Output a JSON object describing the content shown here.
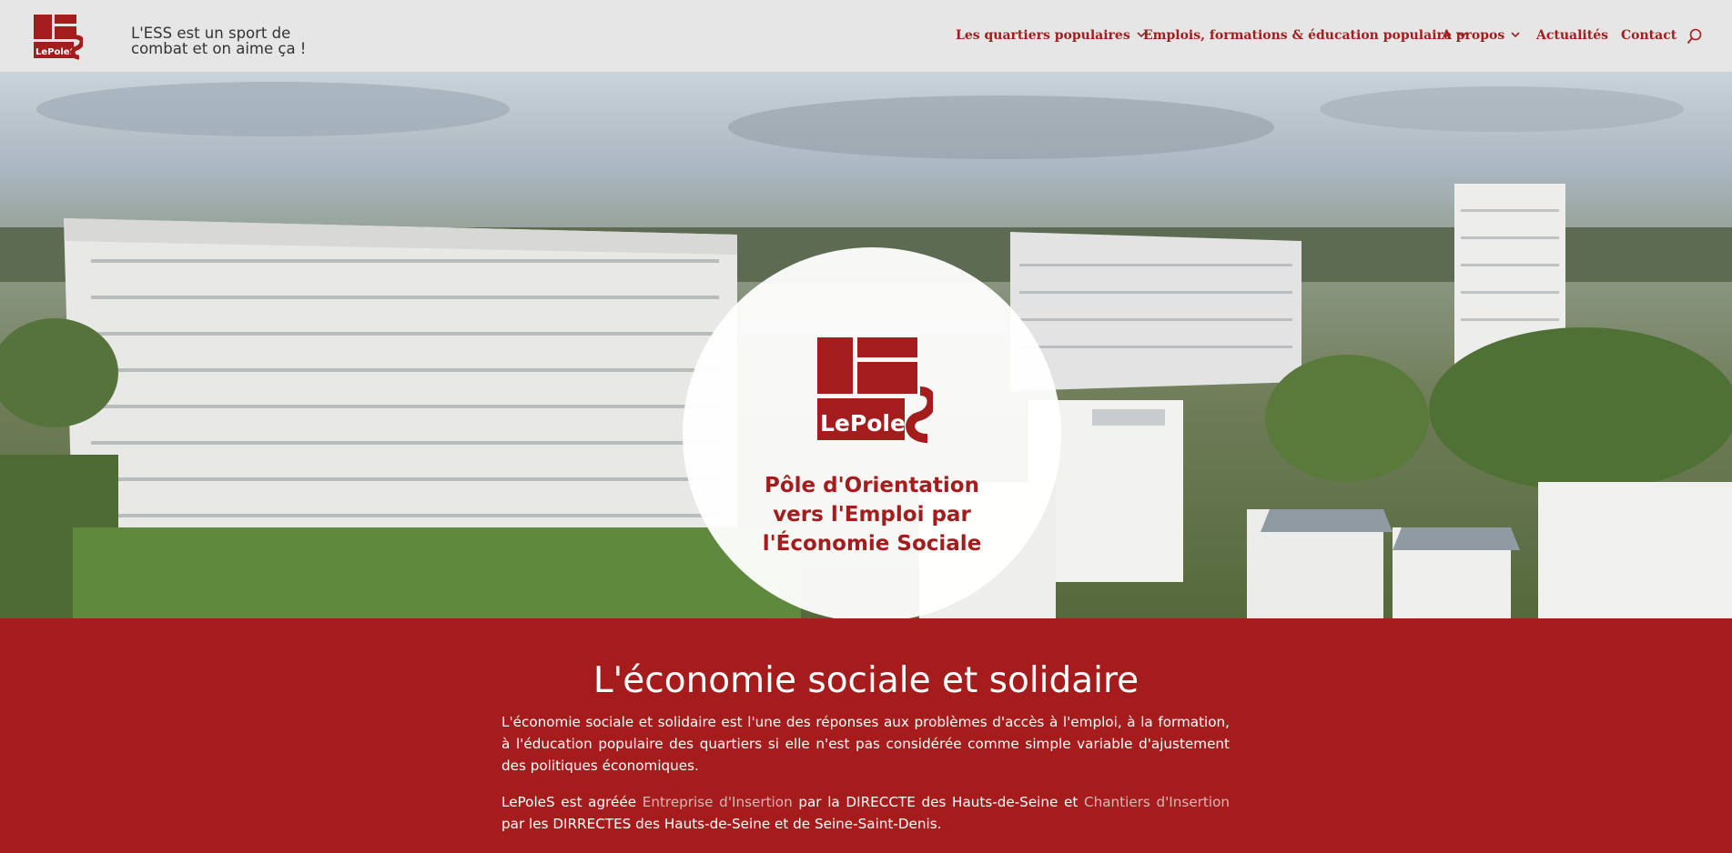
{
  "header": {
    "tagline": "L'ESS est un sport de combat et on aime ça !",
    "nav": [
      {
        "label": "Les quartiers populaires",
        "has_dropdown": true
      },
      {
        "label": "Emplois, formations & éducation populaire",
        "has_dropdown": true
      },
      {
        "label": "A propos",
        "has_dropdown": true
      },
      {
        "label": "Actualités",
        "has_dropdown": false
      },
      {
        "label": "Contact",
        "has_dropdown": false
      }
    ],
    "search_icon": "search-icon"
  },
  "hero": {
    "logo_text": "LePoleS",
    "title": "Pôle d'Orientation vers l'Emploi par l'Économie Sociale"
  },
  "section": {
    "title": "L'économie sociale et solidaire",
    "paragraph1": "L'économie sociale et solidaire est l'une des réponses aux problèmes d'accès à l'emploi, à la formation, à l'éducation populaire des quartiers si elle n'est pas considérée comme simple variable d'ajustement des politiques économiques.",
    "p2_part1": "LePoleS est agréée ",
    "p2_link1": "Entreprise d'Insertion",
    "p2_part2": " par la DIRECCTE des Hauts-de-Seine et ",
    "p2_link2": "Chantiers d'Insertion",
    "p2_part3": " par les DIRRECTES des Hauts-de-Seine et de Seine-Saint-Denis."
  },
  "colors": {
    "brand_red": "#a61c1c",
    "header_bg": "#e6e6e6",
    "link_muted": "#d9b7b7"
  }
}
